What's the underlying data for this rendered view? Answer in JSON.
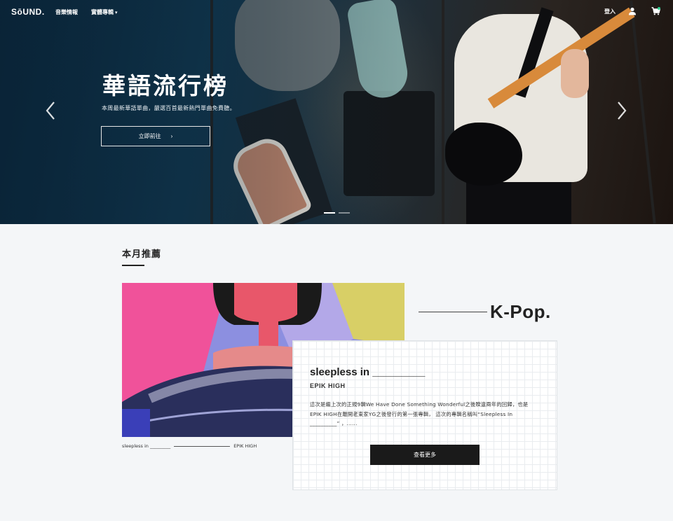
{
  "nav": {
    "logo": "SōUND.",
    "links": [
      {
        "label": "音樂情報"
      },
      {
        "label": "實體專輯",
        "has_dropdown": true
      }
    ],
    "login": "登入",
    "icons": [
      "user-icon",
      "cart-icon"
    ]
  },
  "hero": {
    "title": "華語流行榜",
    "subtitle": "本周最新華語單曲，嚴選百首最新熱門單曲免費聽。",
    "button": "立即前往",
    "slides": 2,
    "active_slide": 0
  },
  "recommend": {
    "heading": "本月推薦",
    "genre": "K-Pop.",
    "album": {
      "caption_title": "sleepless in _________",
      "caption_artist": "EPIK HIGH",
      "title": "sleepless in _________",
      "artist": "EPIK HIGH",
      "description": "這次是繼上次的正規9輯We Have Done Something Wonderful之後睽違兩年的回歸，也是EPIK HIGH在離開老東家YG之後發行的第一張專輯， 這次的專輯名稱叫“Sleepless In __________” ，......",
      "button": "查看更多"
    }
  },
  "colors": {
    "hero_bg": "#123a52",
    "accent_green": "#2ecc91",
    "dark_button": "#1a1a1a"
  }
}
